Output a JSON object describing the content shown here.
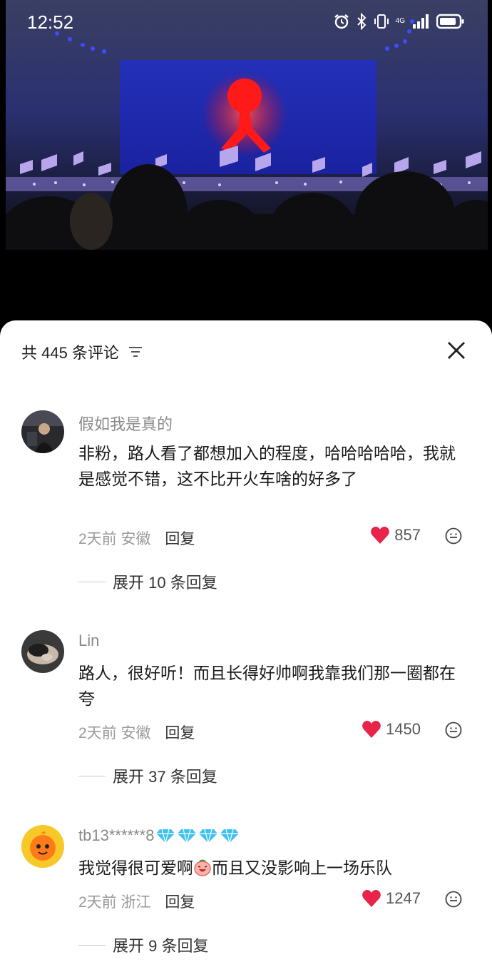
{
  "status_bar": {
    "time": "12:52",
    "network": "4G",
    "icons": [
      "alarm-icon",
      "bluetooth-icon",
      "vibrate-icon",
      "signal-icon",
      "battery-icon"
    ]
  },
  "photo": {
    "subject": "concert-stage"
  },
  "sheet": {
    "title": "共 445 条评论",
    "sort_icon": "sort-icon",
    "close_icon": "close-icon"
  },
  "comments": [
    {
      "user": "假如我是真的",
      "text": "非粉，路人看了都想加入的程度，哈哈哈哈哈，我就是感觉不错，这不比开火车啥的好多了",
      "time": "2天前",
      "location": "安徽",
      "reply_label": "回复",
      "likes": "857",
      "expand_label": "展开 10 条回复"
    },
    {
      "user": "Lin",
      "text": "路人，很好听！而且长得好帅啊我靠我们那一圈都在夸",
      "time": "2天前",
      "location": "安徽",
      "reply_label": "回复",
      "likes": "1450",
      "expand_label": "展开 37 条回复"
    },
    {
      "user": "tb13******8",
      "user_badges": [
        "diamond-icon",
        "diamond-icon",
        "diamond-icon",
        "diamond-icon"
      ],
      "text_part1": "我觉得很可爱啊",
      "text_emoji": "laughing-emoji-icon",
      "text_part2": "而且又没影响上一场乐队",
      "time": "2天前",
      "location": "浙江",
      "reply_label": "回复",
      "likes": "1247",
      "expand_label": "展开 9 条回复"
    }
  ],
  "colors": {
    "like_heart": "#e8244a",
    "diamond": "#3fc1f0",
    "stage_figure": "#ff1a1a",
    "stage_backdrop": "#1b2bb8"
  }
}
